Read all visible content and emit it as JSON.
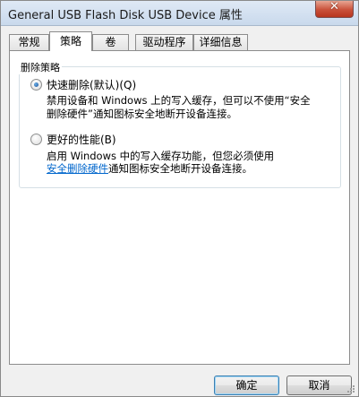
{
  "window": {
    "title": "General USB Flash Disk USB Device 属性",
    "close_glyph": "✕"
  },
  "tabs": [
    {
      "label": "常规",
      "active": false
    },
    {
      "label": "策略",
      "active": true
    },
    {
      "label": "卷",
      "active": false
    },
    {
      "label": "驱动程序",
      "active": false
    },
    {
      "label": "详细信息",
      "active": false
    }
  ],
  "group": {
    "legend": "删除策略",
    "options": [
      {
        "label": "快速删除(默认)(Q)",
        "selected": true,
        "desc_line1": "禁用设备和 Windows 上的写入缓存，但可以不使用“安全",
        "desc_line2": "删除硬件”通知图标安全地断开设备连接。"
      },
      {
        "label": "更好的性能(B)",
        "selected": false,
        "desc_line1": "启用 Windows 中的写入缓存功能，但您必须使用",
        "desc_link": "安全删除硬件",
        "desc_line2_rest": "通知图标安全地断开设备连接。"
      }
    ]
  },
  "buttons": {
    "ok": "确定",
    "cancel": "取消"
  },
  "icons": {
    "close": "close-icon",
    "resize": "resize-grip-icon"
  }
}
